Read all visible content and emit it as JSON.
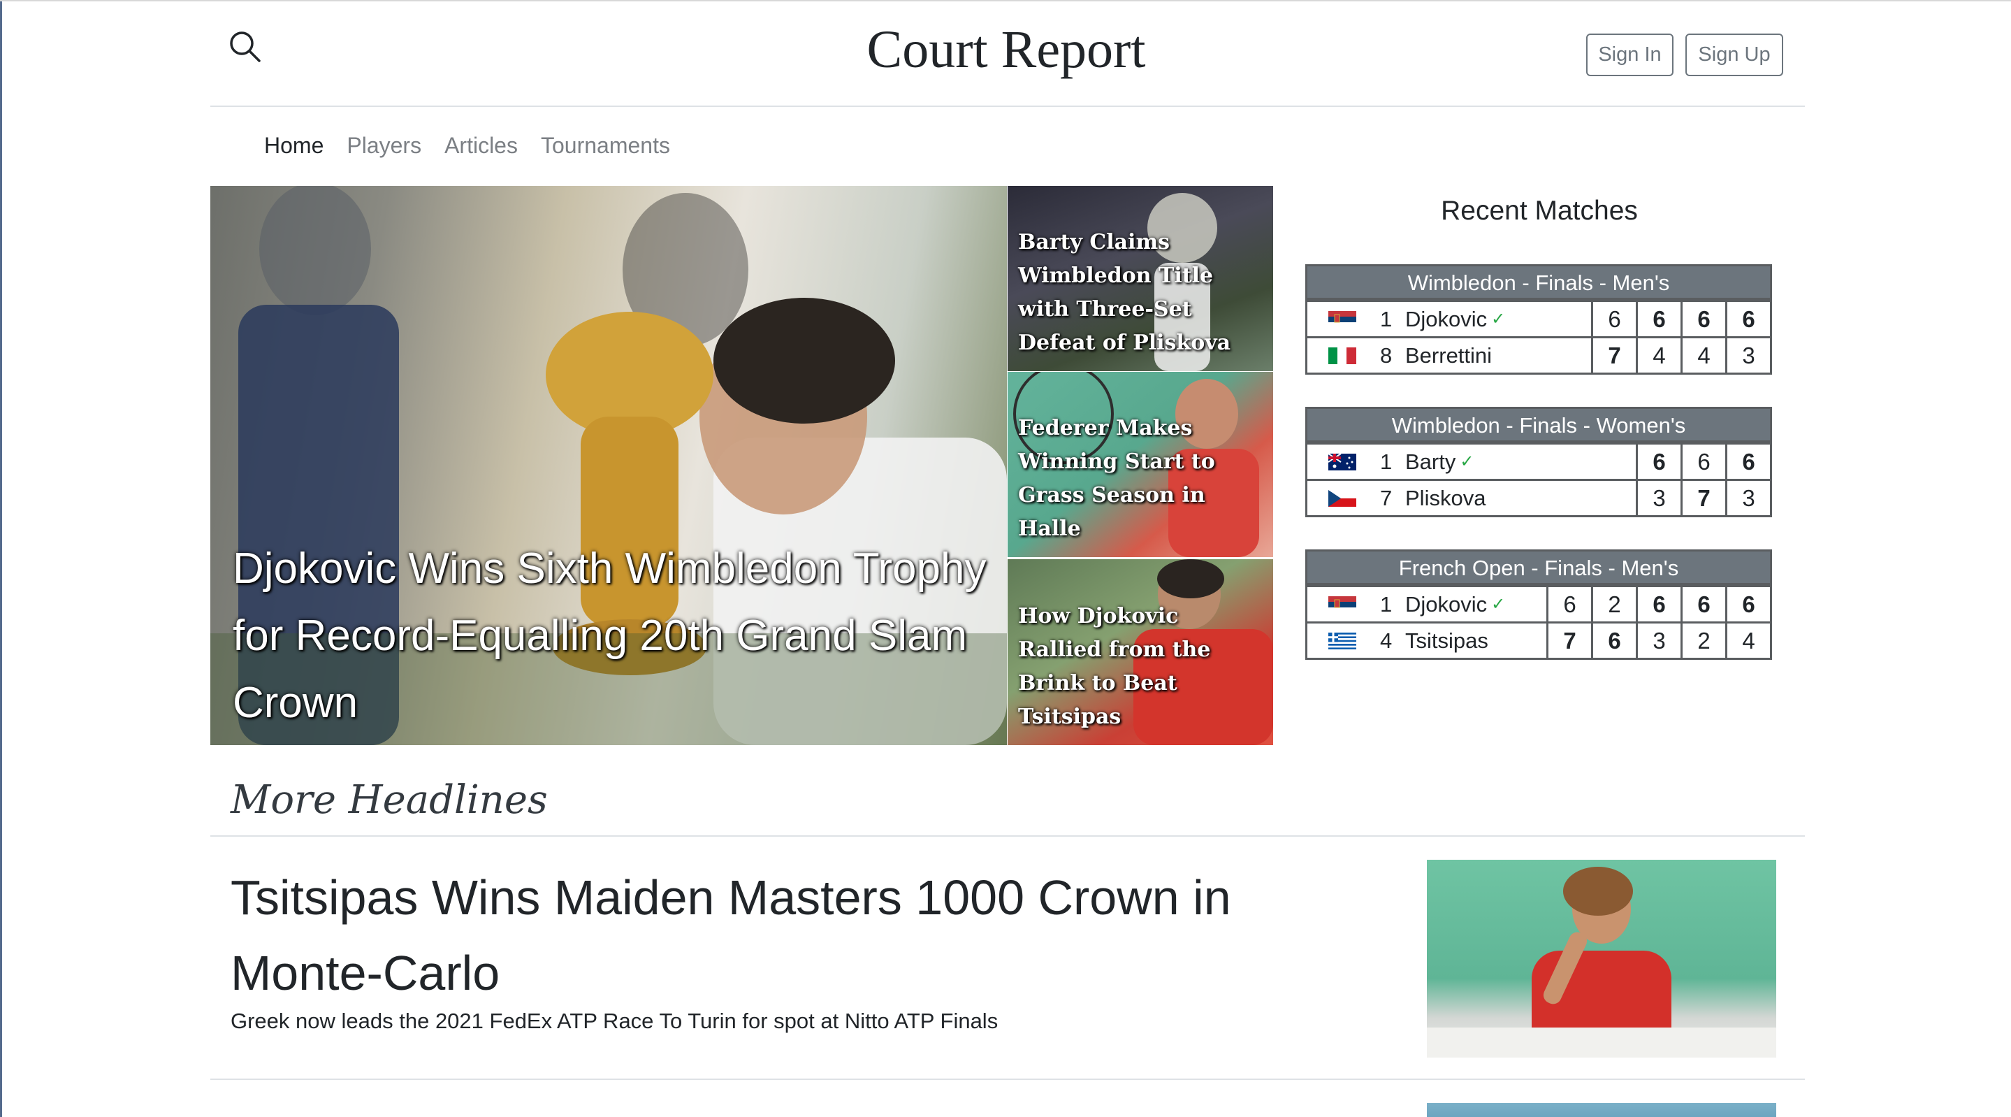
{
  "header": {
    "brand": "Court Report",
    "sign_in": "Sign In",
    "sign_up": "Sign Up"
  },
  "nav": {
    "items": [
      {
        "label": "Home",
        "active": true
      },
      {
        "label": "Players",
        "active": false
      },
      {
        "label": "Articles",
        "active": false
      },
      {
        "label": "Tournaments",
        "active": false
      }
    ]
  },
  "hero": {
    "main_title": "Djokovic Wins Sixth Wimbledon Trophy for Record-Equalling 20th Grand Slam Crown",
    "side_stories": [
      {
        "title": "Barty Claims Wimbledon Title with Three-Set Defeat of Pliskova"
      },
      {
        "title": "Federer Makes Winning Start to Grass Season in Halle"
      },
      {
        "title": "How Djokovic Rallied from the Brink to Beat Tsitsipas"
      }
    ]
  },
  "recent_matches": {
    "title": "Recent Matches",
    "matches": [
      {
        "heading": "Wimbledon - Finals - Men's",
        "players": [
          {
            "flag": "serbia-flag-icon",
            "seed": "1",
            "name": "Djokovic",
            "winner": true,
            "sets": [
              "6",
              "6",
              "6",
              "6"
            ],
            "won": [
              false,
              true,
              true,
              true
            ]
          },
          {
            "flag": "italy-flag-icon",
            "seed": "8",
            "name": "Berrettini",
            "winner": false,
            "sets": [
              "7",
              "4",
              "4",
              "3"
            ],
            "won": [
              true,
              false,
              false,
              false
            ]
          }
        ]
      },
      {
        "heading": "Wimbledon - Finals - Women's",
        "players": [
          {
            "flag": "australia-flag-icon",
            "seed": "1",
            "name": "Barty",
            "winner": true,
            "sets": [
              "6",
              "6",
              "6"
            ],
            "won": [
              true,
              false,
              true
            ]
          },
          {
            "flag": "czech-flag-icon",
            "seed": "7",
            "name": "Pliskova",
            "winner": false,
            "sets": [
              "3",
              "7",
              "3"
            ],
            "won": [
              false,
              true,
              false
            ]
          }
        ]
      },
      {
        "heading": "French Open - Finals - Men's",
        "players": [
          {
            "flag": "serbia-flag-icon",
            "seed": "1",
            "name": "Djokovic",
            "winner": true,
            "sets": [
              "6",
              "2",
              "6",
              "6",
              "6"
            ],
            "won": [
              false,
              false,
              true,
              true,
              true
            ]
          },
          {
            "flag": "greece-flag-icon",
            "seed": "4",
            "name": "Tsitsipas",
            "winner": false,
            "sets": [
              "7",
              "6",
              "3",
              "2",
              "4"
            ],
            "won": [
              true,
              true,
              false,
              false,
              false
            ]
          }
        ]
      }
    ]
  },
  "more_headlines": {
    "title": "More Headlines",
    "articles": [
      {
        "title": "Tsitsipas Wins Maiden Masters 1000 Crown in Monte-Carlo",
        "subtitle": "Greek now leads the 2021 FedEx ATP Race To Turin for spot at Nitto ATP Finals"
      }
    ]
  },
  "icons": {
    "search": "search-icon",
    "winner": "checkmark-icon"
  }
}
